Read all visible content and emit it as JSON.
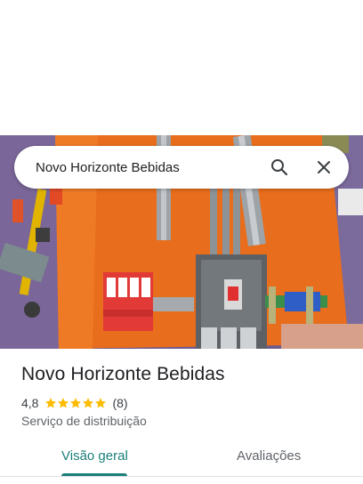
{
  "search": {
    "query": "Novo Horizonte Bebidas"
  },
  "place": {
    "name": "Novo Horizonte Bebidas",
    "rating": "4,8",
    "rating_value": 4.8,
    "stars_max": 5,
    "review_count": "(8)",
    "category": "Serviço de distribuição"
  },
  "tabs": [
    {
      "label": "Visão geral",
      "active": true
    },
    {
      "label": "Avaliações",
      "active": false
    }
  ],
  "icons": {
    "search": "search-icon",
    "close": "close-icon",
    "star": "star-icon"
  },
  "colors": {
    "accent": "#1a7f7a",
    "star": "#fbbc04",
    "text_primary": "#202124",
    "text_secondary": "#5f6368"
  }
}
